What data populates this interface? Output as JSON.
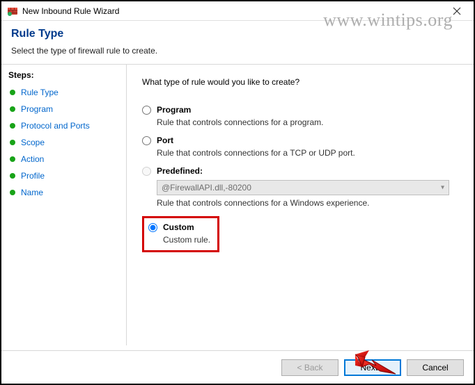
{
  "window": {
    "title": "New Inbound Rule Wizard"
  },
  "watermark": "www.wintips.org",
  "header": {
    "title": "Rule Type",
    "subtitle": "Select the type of firewall rule to create."
  },
  "sidebar": {
    "steps_label": "Steps:",
    "items": [
      {
        "label": "Rule Type"
      },
      {
        "label": "Program"
      },
      {
        "label": "Protocol and Ports"
      },
      {
        "label": "Scope"
      },
      {
        "label": "Action"
      },
      {
        "label": "Profile"
      },
      {
        "label": "Name"
      }
    ]
  },
  "content": {
    "question": "What type of rule would you like to create?",
    "options": {
      "program": {
        "label": "Program",
        "desc": "Rule that controls connections for a program."
      },
      "port": {
        "label": "Port",
        "desc": "Rule that controls connections for a TCP or UDP port."
      },
      "predefined": {
        "label": "Predefined",
        "select_text": "@FirewallAPI.dll,-80200",
        "desc": "Rule that controls connections for a Windows experience."
      },
      "custom": {
        "label": "Custom",
        "desc": "Custom rule."
      }
    }
  },
  "footer": {
    "back": "< Back",
    "next": "Next >",
    "cancel": "Cancel"
  }
}
